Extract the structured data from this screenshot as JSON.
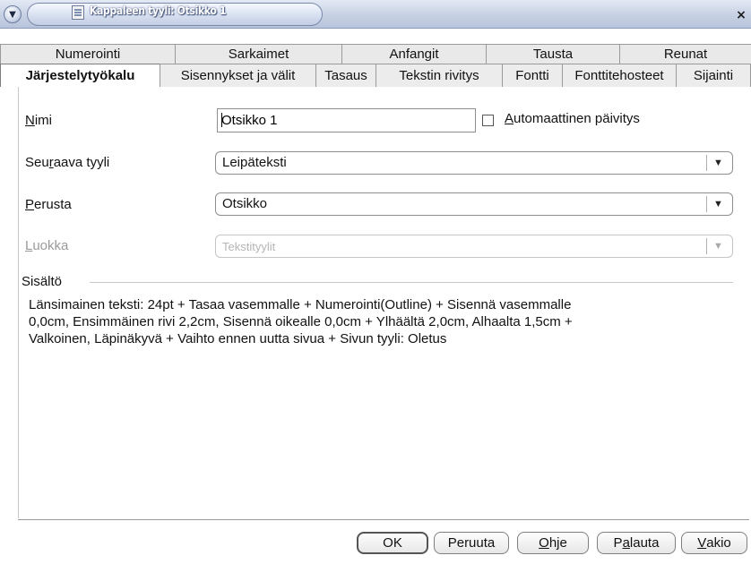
{
  "window": {
    "title": "Kappaleen tyyli: Otsikko 1"
  },
  "tabs_row1": [
    {
      "label": "Numerointi"
    },
    {
      "label": "Sarkaimet"
    },
    {
      "label": "Anfangit"
    },
    {
      "label": "Tausta"
    },
    {
      "label": "Reunat"
    }
  ],
  "tabs_row2": [
    {
      "label": "Järjestelytyökalu",
      "active": true
    },
    {
      "label": "Sisennykset ja välit"
    },
    {
      "label": "Tasaus"
    },
    {
      "label": "Tekstin rivitys"
    },
    {
      "label": "Fontti"
    },
    {
      "label": "Fonttitehosteet"
    },
    {
      "label": "Sijainti"
    }
  ],
  "form": {
    "name_label_pre": "",
    "name_label_u": "N",
    "name_label_post": "imi",
    "name_value": "Otsikko 1",
    "autoupdate_u": "A",
    "autoupdate_post": "utomaattinen päivitys",
    "next_style_pre": "Seu",
    "next_style_u": "r",
    "next_style_post": "aava tyyli",
    "next_style_value": "Leipäteksti",
    "based_on_pre": "",
    "based_on_u": "P",
    "based_on_post": "erusta",
    "based_on_value": "Otsikko",
    "category_pre": "",
    "category_u": "L",
    "category_post": "uokka",
    "category_value": "Tekstityylit"
  },
  "contents": {
    "group_label": "Sisältö",
    "line1": "Länsimainen teksti: 24pt + Tasaa vasemmalle + Numerointi(Outline) + Sisennä vasemmalle",
    "line2": "0,0cm, Ensimmäinen rivi 2,2cm, Sisennä oikealle 0,0cm + Ylhäältä 2,0cm, Alhaalta 1,5cm +",
    "line3": "Valkoinen, Läpinäkyvä + Vaihto ennen uutta sivua + Sivun tyyli: Oletus"
  },
  "buttons": {
    "ok": "OK",
    "cancel": "Peruuta",
    "help_u": "O",
    "help_post": "hje",
    "reset_pre": "P",
    "reset_u": "a",
    "reset_post": "lauta",
    "standard_u": "V",
    "standard_post": "akio"
  },
  "icons": {
    "system_menu": "chevron-down-icon",
    "window_icon": "document-icon",
    "close": "close-icon",
    "combo_dropdown": "dropdown-arrow-icon"
  }
}
